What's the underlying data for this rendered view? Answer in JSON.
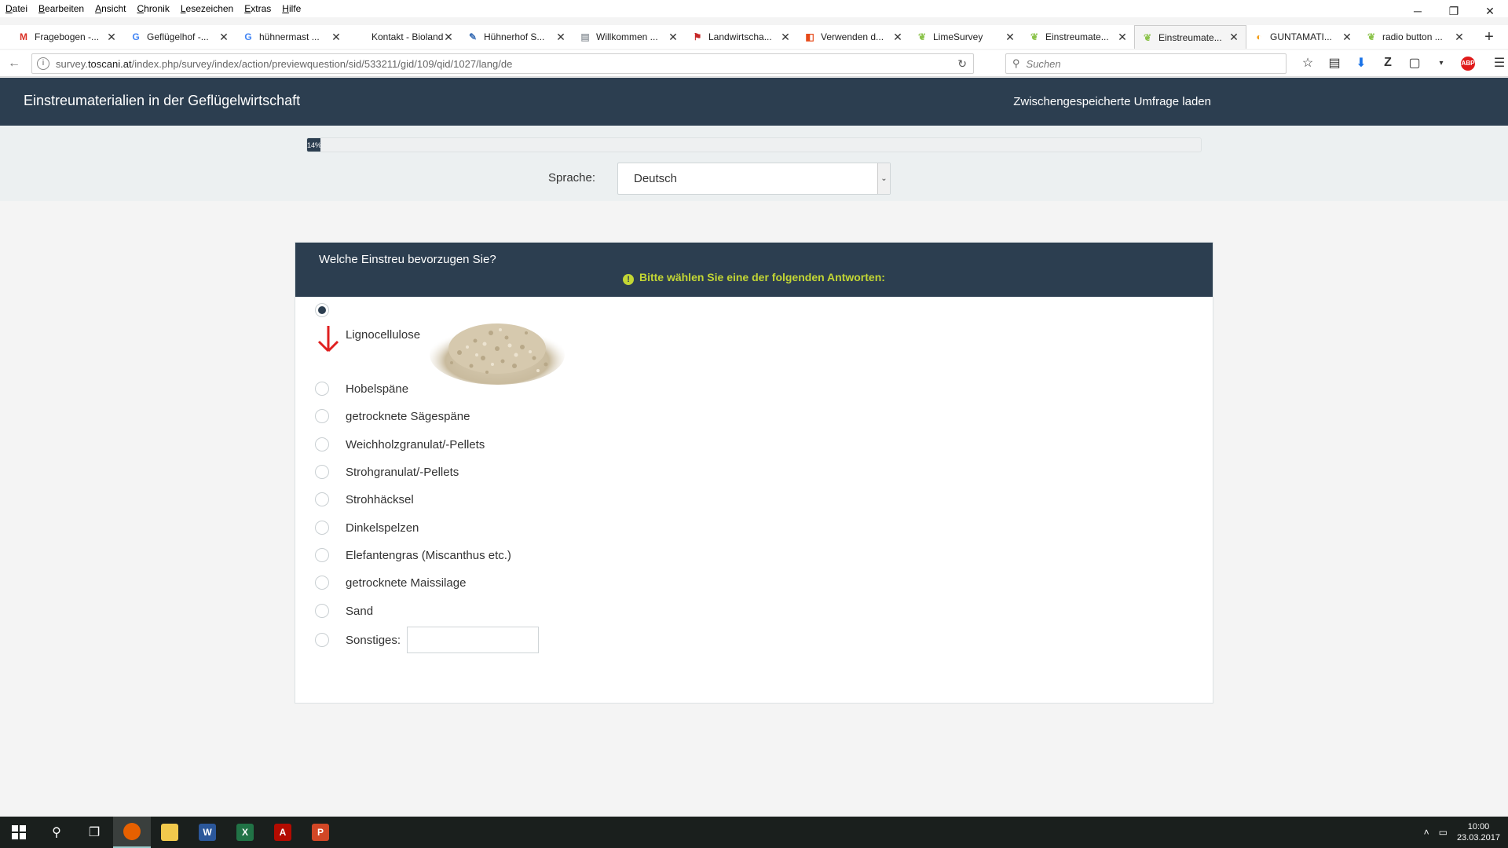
{
  "browser": {
    "menu": [
      "Datei",
      "Bearbeiten",
      "Ansicht",
      "Chronik",
      "Lesezeichen",
      "Extras",
      "Hilfe"
    ],
    "tabs": [
      {
        "title": "Fragebogen -...",
        "icon": "gmail-icon",
        "icon_color": "#d93025",
        "glyph": "M"
      },
      {
        "title": "Geflügelhof -...",
        "icon": "google-icon",
        "icon_color": "#4285f4",
        "glyph": "G"
      },
      {
        "title": "hühnermast ...",
        "icon": "google-icon",
        "icon_color": "#4285f4",
        "glyph": "G"
      },
      {
        "title": "Kontakt - Bioland...",
        "icon": "page-icon",
        "icon_color": "#888888",
        "glyph": ""
      },
      {
        "title": "Hühnerhof S...",
        "icon": "chicken-icon",
        "icon_color": "#3b6fb6",
        "glyph": "✎"
      },
      {
        "title": "Willkommen ...",
        "icon": "page-icon",
        "icon_color": "#9aa0a6",
        "glyph": "▤"
      },
      {
        "title": "Landwirtscha...",
        "icon": "pdf-icon",
        "icon_color": "#c62828",
        "glyph": "⚑"
      },
      {
        "title": "Verwenden d...",
        "icon": "office-icon",
        "icon_color": "#e64a19",
        "glyph": "◧"
      },
      {
        "title": "LimeSurvey",
        "icon": "limesurvey-icon",
        "icon_color": "#8bc34a",
        "glyph": "❦"
      },
      {
        "title": "Einstreumate...",
        "icon": "limesurvey-icon",
        "icon_color": "#8bc34a",
        "glyph": "❦"
      },
      {
        "title": "Einstreumate...",
        "icon": "limesurvey-icon",
        "icon_color": "#8bc34a",
        "glyph": "❦",
        "active": true
      },
      {
        "title": "GUNTAMATI...",
        "icon": "guntamatic-icon",
        "icon_color": "#f39c12",
        "glyph": "◐"
      },
      {
        "title": "radio button ...",
        "icon": "limesurvey-icon",
        "icon_color": "#8bc34a",
        "glyph": "❦"
      }
    ],
    "url_prefix": "survey.",
    "url_host": "toscani.at",
    "url_path": "/index.php/survey/index/action/previewquestion/sid/533211/gid/109/qid/1027/lang/de",
    "search_placeholder": "Suchen",
    "abp_label": "ABP"
  },
  "survey": {
    "title": "Einstreumaterialien in der Geflügelwirtschaft",
    "load_link": "Zwischengespeicherte Umfrage laden",
    "progress_percent": 1,
    "progress_label": "14%",
    "language_label": "Sprache:",
    "language_value": "Deutsch",
    "question": "Welche Einstreu bevorzugen Sie?",
    "help_icon": "!",
    "help_text": "Bitte wählen Sie eine der folgenden Antworten:",
    "selected_index": 0,
    "options": [
      "Lignocellulose",
      "Hobelspäne",
      "getrocknete Sägespäne",
      "Weichholzgranulat/-Pellets",
      "Strohgranulat/-Pellets",
      "Strohhäcksel",
      "Dinkelspelzen",
      "Elefantengras (Miscanthus etc.)",
      "getrocknete Maissilage",
      "Sand",
      "Sonstiges:"
    ],
    "other_value": ""
  },
  "taskbar": {
    "time": "10:00",
    "date": "23.03.2017",
    "apps": [
      {
        "name": "firefox-icon",
        "label": "",
        "color": "#e66000"
      },
      {
        "name": "file-explorer-icon",
        "label": "",
        "color": "#f2c94c"
      },
      {
        "name": "word-icon",
        "label": "W",
        "color": "#2b579a"
      },
      {
        "name": "excel-icon",
        "label": "X",
        "color": "#217346"
      },
      {
        "name": "acrobat-icon",
        "label": "A",
        "color": "#b30b00"
      },
      {
        "name": "powerpoint-icon",
        "label": "P",
        "color": "#d24726"
      }
    ]
  }
}
